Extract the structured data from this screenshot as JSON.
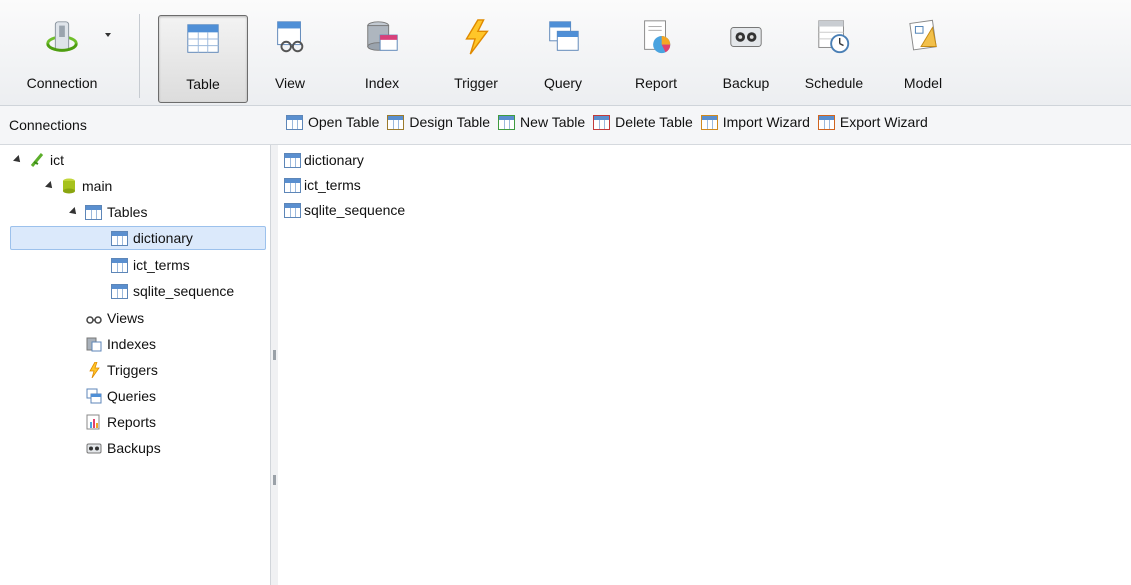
{
  "toolbar": {
    "buttons": [
      {
        "label": "Connection",
        "icon": "connection-icon"
      },
      {
        "label": "Table",
        "icon": "table-icon",
        "active": true
      },
      {
        "label": "View",
        "icon": "view-icon"
      },
      {
        "label": "Index",
        "icon": "index-icon"
      },
      {
        "label": "Trigger",
        "icon": "trigger-icon"
      },
      {
        "label": "Query",
        "icon": "query-icon"
      },
      {
        "label": "Report",
        "icon": "report-icon"
      },
      {
        "label": "Backup",
        "icon": "backup-icon"
      },
      {
        "label": "Schedule",
        "icon": "schedule-icon"
      },
      {
        "label": "Model",
        "icon": "model-icon"
      }
    ]
  },
  "connections_title": "Connections",
  "actions": [
    {
      "label": "Open Table",
      "icon": "open-table-icon"
    },
    {
      "label": "Design Table",
      "icon": "design-table-icon"
    },
    {
      "label": "New Table",
      "icon": "new-table-icon"
    },
    {
      "label": "Delete Table",
      "icon": "delete-table-icon"
    },
    {
      "label": "Import Wizard",
      "icon": "import-wizard-icon"
    },
    {
      "label": "Export Wizard",
      "icon": "export-wizard-icon"
    }
  ],
  "tree": {
    "connection": "ict",
    "database": "main",
    "tables_group": "Tables",
    "tables": [
      "dictionary",
      "ict_terms",
      "sqlite_sequence"
    ],
    "selected_table": "dictionary",
    "groups": [
      "Views",
      "Indexes",
      "Triggers",
      "Queries",
      "Reports",
      "Backups"
    ]
  },
  "table_list": [
    "dictionary",
    "ict_terms",
    "sqlite_sequence"
  ],
  "colors": {
    "selection": "#dbe9fb",
    "accent": "#5a8fcf"
  }
}
